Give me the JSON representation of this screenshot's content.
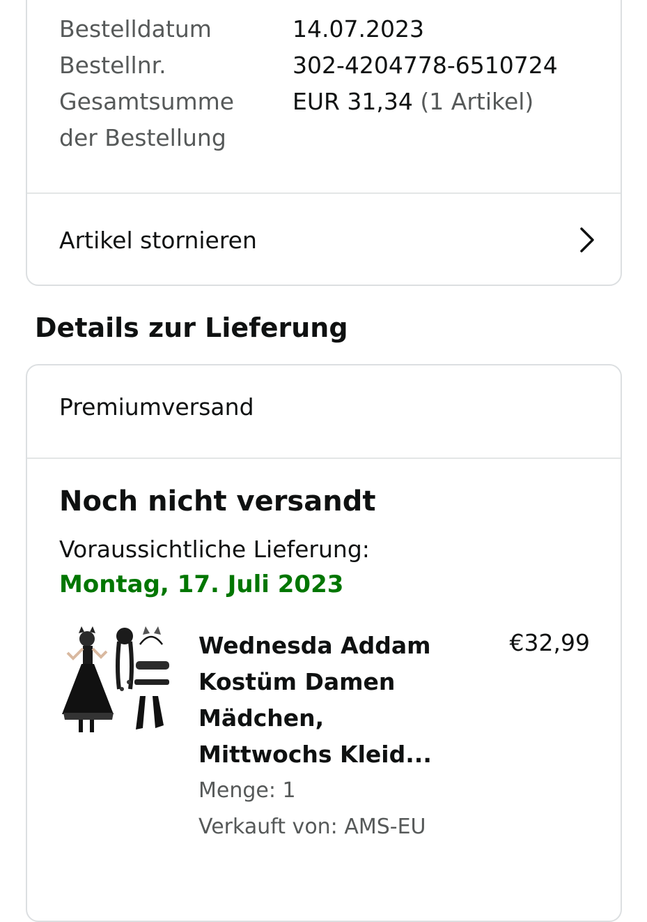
{
  "order_summary": {
    "date_label": "Bestelldatum",
    "date_value": "14.07.2023",
    "number_label": "Bestellnr.",
    "number_value": "302-4204778-6510724",
    "total_label_line1": "Gesamtsumme",
    "total_label_line2": "der Bestellung",
    "total_value": "EUR 31,34",
    "total_items": "(1 Artikel)",
    "cancel_link": "Artikel stornieren",
    "cancel_icon": "chevron-right-icon"
  },
  "delivery": {
    "section_title": "Details zur Lieferung",
    "shipping_method": "Premiumversand",
    "status": "Noch nicht versandt",
    "eta_label": "Voraussichtliche Lieferung:",
    "eta_date": "Montag, 17. Juli 2023",
    "eta_color": "#007600"
  },
  "item": {
    "title_lines": [
      "Wednesda Addam",
      "Kostüm Damen",
      "Mädchen,",
      "Mittwochs Kleid..."
    ],
    "price": "€32,99",
    "quantity": "Menge: 1",
    "seller": "Verkauft von: AMS-EU",
    "image": "costume-product-image"
  }
}
